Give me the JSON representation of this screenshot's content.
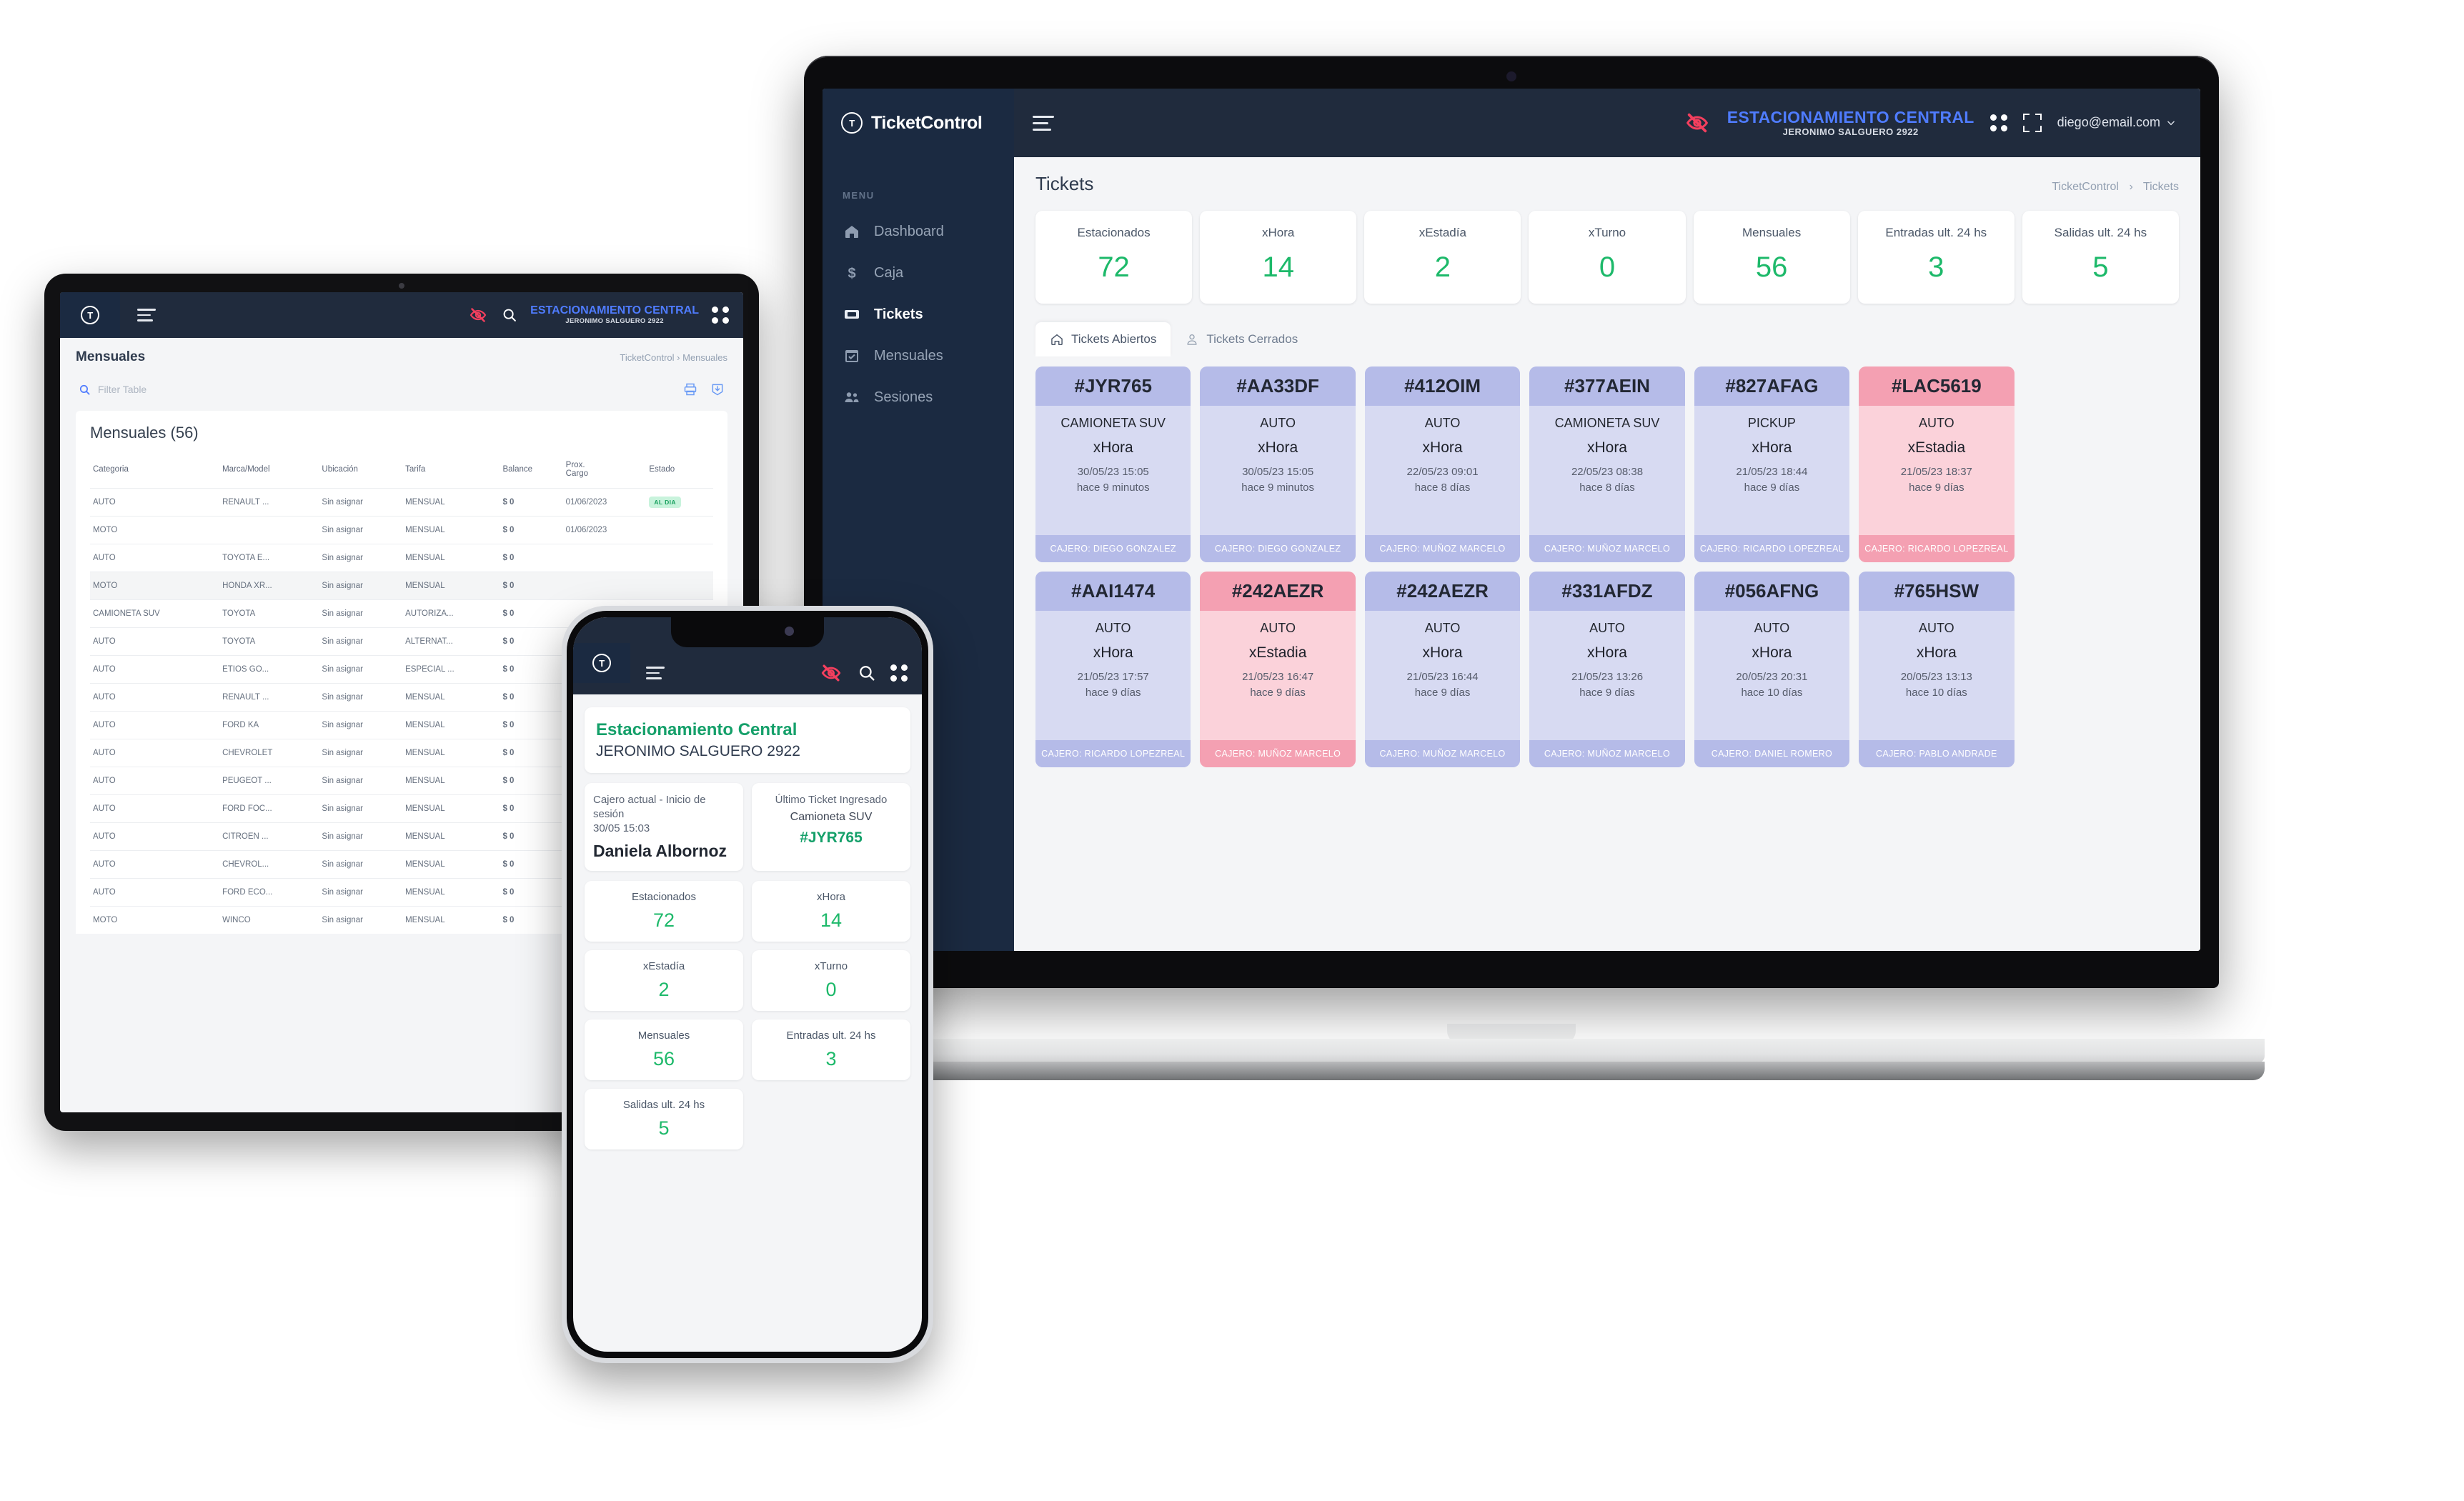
{
  "brand": {
    "name": "TicketControl",
    "mark": "ticket-logo"
  },
  "laptop": {
    "sidebar": {
      "menu_label": "MENU",
      "items": [
        {
          "label": "Dashboard",
          "icon": "home-icon",
          "active": false
        },
        {
          "label": "Caja",
          "icon": "dollar-icon",
          "active": false
        },
        {
          "label": "Tickets",
          "icon": "ticket-icon",
          "active": true
        },
        {
          "label": "Mensuales",
          "icon": "calendar-check-icon",
          "active": false
        },
        {
          "label": "Sesiones",
          "icon": "users-icon",
          "active": false
        }
      ]
    },
    "topbar": {
      "menu_toggle": "hamburger-icon",
      "eye_off": "eye-off-icon",
      "site_name": "ESTACIONAMIENTO CENTRAL",
      "site_address": "JERONIMO SALGUERO 2922",
      "apps_icon": "grid-apps-icon",
      "fullscreen_icon": "fullscreen-icon",
      "user_email": "diego@email.com",
      "user_chevron": "chevron-down-icon"
    },
    "page": {
      "title": "Tickets",
      "breadcrumb_root": "TicketControl",
      "breadcrumb_sep": "›",
      "breadcrumb_current": "Tickets"
    },
    "stats": [
      {
        "label": "Estacionados",
        "value": "72"
      },
      {
        "label": "xHora",
        "value": "14"
      },
      {
        "label": "xEstadía",
        "value": "2"
      },
      {
        "label": "xTurno",
        "value": "0"
      },
      {
        "label": "Mensuales",
        "value": "56"
      },
      {
        "label": "Entradas ult. 24 hs",
        "value": "3"
      },
      {
        "label": "Salidas ult. 24 hs",
        "value": "5"
      }
    ],
    "tabs": [
      {
        "label": "Tickets Abiertos",
        "icon": "home-outline-icon",
        "active": true
      },
      {
        "label": "Tickets Cerrados",
        "icon": "person-icon",
        "active": false
      }
    ],
    "tickets": [
      {
        "id": "#JYR765",
        "type": "CAMIONETA SUV",
        "mode": "xHora",
        "datetime": "30/05/23 15:05",
        "ago": "hace 9 minutos",
        "cashier": "CAJERO: DIEGO GONZALEZ",
        "color": "blue"
      },
      {
        "id": "#AA33DF",
        "type": "AUTO",
        "mode": "xHora",
        "datetime": "30/05/23 15:05",
        "ago": "hace 9 minutos",
        "cashier": "CAJERO: DIEGO GONZALEZ",
        "color": "blue"
      },
      {
        "id": "#412OIM",
        "type": "AUTO",
        "mode": "xHora",
        "datetime": "22/05/23 09:01",
        "ago": "hace 8 días",
        "cashier": "CAJERO: MUÑOZ MARCELO",
        "color": "blue"
      },
      {
        "id": "#377AEIN",
        "type": "CAMIONETA SUV",
        "mode": "xHora",
        "datetime": "22/05/23 08:38",
        "ago": "hace 8 días",
        "cashier": "CAJERO: MUÑOZ MARCELO",
        "color": "blue"
      },
      {
        "id": "#827AFAG",
        "type": "PICKUP",
        "mode": "xHora",
        "datetime": "21/05/23 18:44",
        "ago": "hace 9 días",
        "cashier": "CAJERO: RICARDO LOPEZREAL",
        "color": "blue"
      },
      {
        "id": "#LAC5619",
        "type": "AUTO",
        "mode": "xEstadia",
        "datetime": "21/05/23 18:37",
        "ago": "hace 9 días",
        "cashier": "CAJERO: RICARDO LOPEZREAL",
        "color": "red"
      },
      {
        "id": "",
        "type": "",
        "mode": "",
        "datetime": "",
        "ago": "",
        "cashier": "",
        "color": "hidden"
      },
      {
        "id": "#AAI1474",
        "type": "AUTO",
        "mode": "xHora",
        "datetime": "21/05/23 17:57",
        "ago": "hace 9 días",
        "cashier": "CAJERO: RICARDO LOPEZREAL",
        "color": "blue"
      },
      {
        "id": "#242AEZR",
        "type": "AUTO",
        "mode": "xEstadia",
        "datetime": "21/05/23 16:47",
        "ago": "hace 9 días",
        "cashier": "CAJERO: MUÑOZ MARCELO",
        "color": "red"
      },
      {
        "id": "#242AEZR",
        "type": "AUTO",
        "mode": "xHora",
        "datetime": "21/05/23 16:44",
        "ago": "hace 9 días",
        "cashier": "CAJERO: MUÑOZ MARCELO",
        "color": "blue"
      },
      {
        "id": "#331AFDZ",
        "type": "AUTO",
        "mode": "xHora",
        "datetime": "21/05/23 13:26",
        "ago": "hace 9 días",
        "cashier": "CAJERO: MUÑOZ MARCELO",
        "color": "blue"
      },
      {
        "id": "#056AFNG",
        "type": "AUTO",
        "mode": "xHora",
        "datetime": "20/05/23 20:31",
        "ago": "hace 10 días",
        "cashier": "CAJERO: DANIEL ROMERO",
        "color": "blue"
      },
      {
        "id": "#765HSW",
        "type": "AUTO",
        "mode": "xHora",
        "datetime": "20/05/23 13:13",
        "ago": "hace 10 días",
        "cashier": "CAJERO: PABLO ANDRADE",
        "color": "blue"
      },
      {
        "id": "",
        "type": "",
        "mode": "",
        "datetime": "",
        "ago": "",
        "cashier": "",
        "color": "hidden"
      }
    ]
  },
  "tablet": {
    "topbar": {
      "eye_off": "eye-off-icon",
      "search_icon": "search-icon",
      "site_name": "ESTACIONAMIENTO CENTRAL",
      "site_address": "JERONIMO SALGUERO 2922",
      "apps_icon": "grid-apps-icon"
    },
    "page": {
      "title": "Mensuales",
      "breadcrumb_root": "TicketControl",
      "breadcrumb_sep": "›",
      "breadcrumb_current": "Mensuales"
    },
    "filter": {
      "placeholder": "Filter Table",
      "search_icon": "search-icon",
      "print_icon": "print-icon",
      "download_icon": "download-icon"
    },
    "table": {
      "caption": "Mensuales (56)",
      "columns": [
        "Categoria",
        "Marca/Model",
        "Ubicación",
        "Tarifa",
        "Balance",
        "Prox. Cargo",
        "Estado"
      ],
      "rows": [
        {
          "cells": [
            "AUTO",
            "RENAULT ...",
            "Sin asignar",
            "MENSUAL",
            "$ 0",
            "01/06/2023",
            "AL DIA"
          ],
          "badge": true
        },
        {
          "cells": [
            "MOTO",
            "",
            "Sin asignar",
            "MENSUAL",
            "$ 0",
            "01/06/2023",
            ""
          ],
          "badge": false
        },
        {
          "cells": [
            "AUTO",
            "TOYOTA E...",
            "Sin asignar",
            "MENSUAL",
            "$ 0",
            "",
            ""
          ],
          "badge": false
        },
        {
          "cells": [
            "MOTO",
            "HONDA XR...",
            "Sin asignar",
            "MENSUAL",
            "$ 0",
            "",
            ""
          ],
          "badge": false,
          "alt": true
        },
        {
          "cells": [
            "CAMIONETA SUV",
            "TOYOTA",
            "Sin asignar",
            "AUTORIZA...",
            "$ 0",
            "",
            ""
          ],
          "badge": false
        },
        {
          "cells": [
            "AUTO",
            "TOYOTA",
            "Sin asignar",
            "ALTERNAT...",
            "$ 0",
            "",
            ""
          ],
          "badge": false
        },
        {
          "cells": [
            "AUTO",
            "ETIOS GO...",
            "Sin asignar",
            "ESPECIAL ...",
            "$ 0",
            "",
            ""
          ],
          "badge": false
        },
        {
          "cells": [
            "AUTO",
            "RENAULT ...",
            "Sin asignar",
            "MENSUAL",
            "$ 0",
            "",
            ""
          ],
          "badge": false
        },
        {
          "cells": [
            "AUTO",
            "FORD KA",
            "Sin asignar",
            "MENSUAL",
            "$ 0",
            "",
            ""
          ],
          "badge": false
        },
        {
          "cells": [
            "AUTO",
            "CHEVROLET",
            "Sin asignar",
            "MENSUAL",
            "$ 0",
            "",
            ""
          ],
          "badge": false
        },
        {
          "cells": [
            "AUTO",
            "PEUGEOT ...",
            "Sin asignar",
            "MENSUAL",
            "$ 0",
            "",
            ""
          ],
          "badge": false
        },
        {
          "cells": [
            "AUTO",
            "FORD FOC...",
            "Sin asignar",
            "MENSUAL",
            "$ 0",
            "",
            ""
          ],
          "badge": false
        },
        {
          "cells": [
            "AUTO",
            "CITROEN ...",
            "Sin asignar",
            "MENSUAL",
            "$ 0",
            "",
            ""
          ],
          "badge": false
        },
        {
          "cells": [
            "AUTO",
            "CHEVROL...",
            "Sin asignar",
            "MENSUAL",
            "$ 0",
            "",
            ""
          ],
          "badge": false
        },
        {
          "cells": [
            "AUTO",
            "FORD ECO...",
            "Sin asignar",
            "MENSUAL",
            "$ 0",
            "",
            ""
          ],
          "badge": false
        },
        {
          "cells": [
            "MOTO",
            "WINCO",
            "Sin asignar",
            "MENSUAL",
            "$ 0",
            "",
            ""
          ],
          "badge": false
        }
      ]
    }
  },
  "phone": {
    "topbar": {
      "eye_off": "eye-off-icon",
      "search_icon": "search-icon",
      "apps_icon": "grid-apps-icon"
    },
    "site_name": "Estacionamiento Central",
    "site_address": "JERONIMO SALGUERO 2922",
    "cashier_card": {
      "label": "Cajero actual - Inicio de sesión",
      "time": "30/05 15:03",
      "name": "Daniela Albornoz"
    },
    "last_ticket_card": {
      "label": "Último Ticket Ingresado",
      "type": "Camioneta SUV",
      "id": "#JYR765"
    },
    "stats": [
      {
        "label": "Estacionados",
        "value": "72"
      },
      {
        "label": "xHora",
        "value": "14"
      },
      {
        "label": "xEstadía",
        "value": "2"
      },
      {
        "label": "xTurno",
        "value": "0"
      },
      {
        "label": "Mensuales",
        "value": "56"
      },
      {
        "label": "Entradas ult. 24 hs",
        "value": "3"
      },
      {
        "label": "Salidas ult. 24 hs",
        "value": "5"
      }
    ]
  },
  "colors": {
    "sidebar_bg": "#1b2a41",
    "topbar_bg": "#202b3d",
    "accent_green": "#1db96a",
    "accent_blue": "#4f7cff",
    "alert_red": "#f43f5e",
    "card_blue": "#b5bbe8",
    "card_red": "#f4a0b2"
  }
}
